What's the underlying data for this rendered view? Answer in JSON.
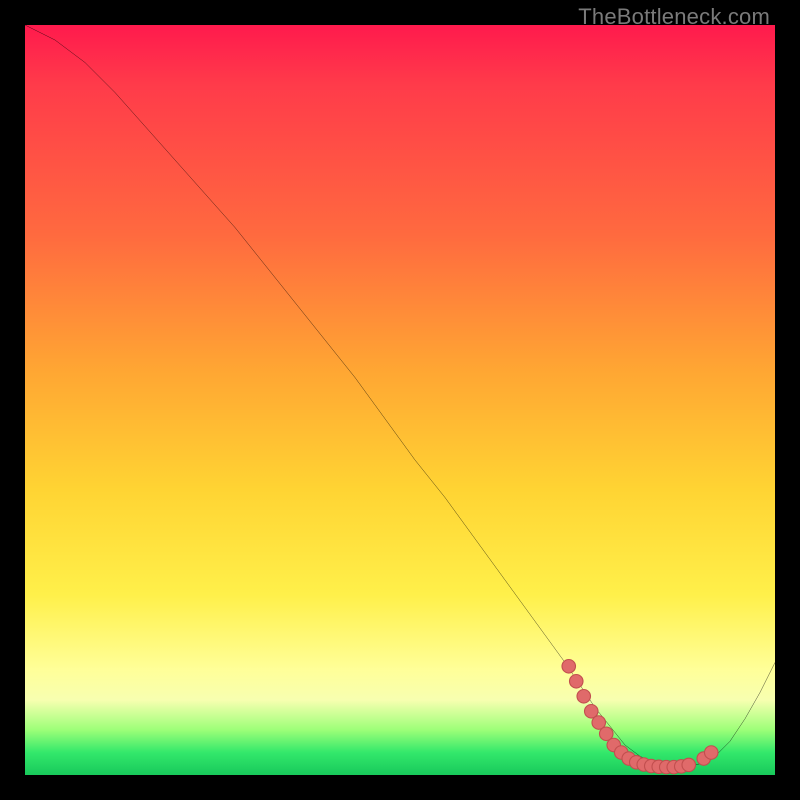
{
  "attribution": "TheBottleneck.com",
  "colors": {
    "background": "#000000",
    "curve_stroke": "#000000",
    "marker_fill": "#e06a6a",
    "marker_stroke": "#c24f4f",
    "gradient_stops": [
      "#ff1a4d",
      "#ff6a3f",
      "#ffd433",
      "#ffff99",
      "#33e86b"
    ]
  },
  "chart_data": {
    "type": "line",
    "title": "",
    "xlabel": "",
    "ylabel": "",
    "xlim": [
      0,
      100
    ],
    "ylim": [
      0,
      100
    ],
    "grid": false,
    "legend": false,
    "series": [
      {
        "name": "curve",
        "x": [
          0,
          4,
          8,
          12,
          16,
          20,
          24,
          28,
          32,
          36,
          40,
          44,
          48,
          52,
          56,
          60,
          64,
          68,
          72,
          74,
          76,
          78,
          80,
          82,
          84,
          86,
          88,
          90,
          92,
          94,
          96,
          98,
          100
        ],
        "y": [
          100,
          98,
          95,
          91,
          86.5,
          82,
          77.5,
          73,
          68,
          63,
          58,
          53,
          47.5,
          42,
          37,
          31.5,
          26,
          20.5,
          15,
          12,
          9,
          6.5,
          4,
          2.5,
          1.5,
          1,
          1,
          1.5,
          2.5,
          4.5,
          7.5,
          11,
          15
        ]
      }
    ],
    "markers": {
      "name": "cluster",
      "x": [
        72.5,
        73.5,
        74.5,
        75.5,
        76.5,
        77.5,
        78.5,
        79.5,
        80.5,
        81.5,
        82.5,
        83.5,
        84.5,
        85.5,
        86.5,
        87.5,
        88.5,
        90.5,
        91.5
      ],
      "y": [
        14.5,
        12.5,
        10.5,
        8.5,
        7,
        5.5,
        4,
        3,
        2.2,
        1.7,
        1.4,
        1.2,
        1.1,
        1.05,
        1.05,
        1.15,
        1.35,
        2.2,
        3.0
      ]
    }
  }
}
